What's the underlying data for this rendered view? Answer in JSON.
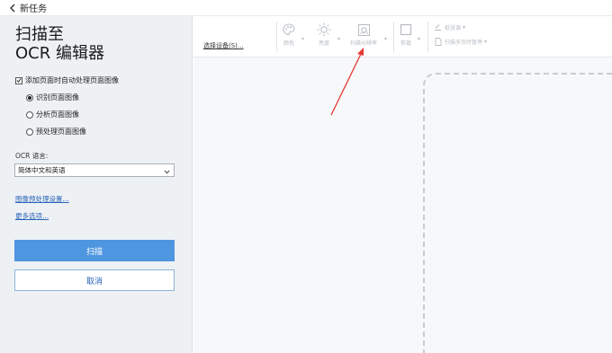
{
  "window": {
    "title": "新任务"
  },
  "sidebar": {
    "heading_line1": "扫描至",
    "heading_line2": "OCR 编辑器",
    "auto_process_label": "添加页面时自动处理页面图像",
    "auto_process_checked": true,
    "options": [
      {
        "label": "识别页面图像",
        "selected": true
      },
      {
        "label": "分析页面图像",
        "selected": false
      },
      {
        "label": "预处理页面图像",
        "selected": false
      }
    ],
    "ocr_language_label": "OCR 语言:",
    "ocr_language_value": "简体中文和英语",
    "preprocess_link": "图像预处理设置...",
    "more_options_link": "更多选项...",
    "scan_button": "扫描",
    "cancel_button": "取消"
  },
  "toolbar": {
    "select_device_link": "选择设备(S)...",
    "tools": [
      {
        "label": "颜色",
        "icon": "palette-icon"
      },
      {
        "label": "亮度",
        "icon": "brightness-icon"
      },
      {
        "label": "扫描分辨率",
        "icon": "scan-resolution-icon"
      },
      {
        "label": "剪裁",
        "icon": "crop-icon"
      }
    ],
    "paper_source_label": "纸张源",
    "multi_page_label": "扫描多页时暂停"
  },
  "colors": {
    "accent": "#4f96e0",
    "link": "#2a64b8",
    "annotation_arrow": "#e53935",
    "panel_bg": "#eef1f4"
  }
}
